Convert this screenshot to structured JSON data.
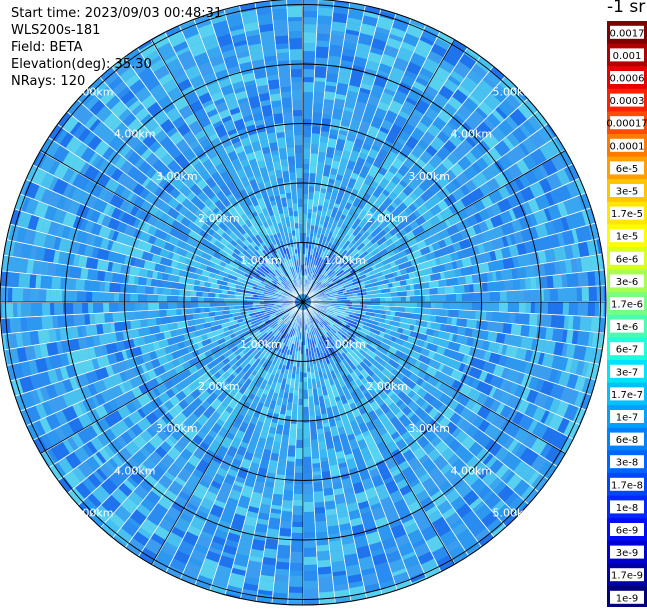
{
  "info": {
    "start_time": "Start time: 2023/09/03 00:48:31",
    "instrument": "WLS200s-181",
    "field": "Field: BETA",
    "elevation": "Elevation(deg): 35.30",
    "nrays": "NRays: 120"
  },
  "chart_data": {
    "type": "heatmap",
    "projection": "polar-ppi",
    "nrays": 120,
    "max_range_km": 5.0,
    "ring_labels": [
      "1.00km",
      "2.00km",
      "3.00km",
      "4.00km",
      "5.00km"
    ],
    "ring_label_units": "km",
    "spokes": 12,
    "colorbar": {
      "title": "-1 sr",
      "labels": [
        "0.0017",
        "0.001",
        "0.0006",
        "0.0003",
        "0.00017",
        "0.0001",
        "6e-5",
        "3e-5",
        "1.7e-5",
        "1e-5",
        "6e-6",
        "3e-6",
        "1.7e-6",
        "1e-6",
        "6e-7",
        "3e-7",
        "1.7e-7",
        "1e-7",
        "6e-8",
        "3e-8",
        "1.7e-8",
        "1e-8",
        "6e-9",
        "3e-9",
        "1.7e-9",
        "1e-9"
      ],
      "colors": [
        "#7f0000",
        "#b00000",
        "#e60000",
        "#ff2000",
        "#ff4c00",
        "#ff7a00",
        "#ffa000",
        "#ffc600",
        "#ffe600",
        "#fffc00",
        "#d8ff1e",
        "#a6ff50",
        "#78ff80",
        "#48ffb0",
        "#1effdc",
        "#00e2ff",
        "#00c0ff",
        "#00a0ff",
        "#0082ff",
        "#0064ff",
        "#0046ff",
        "#0028ff",
        "#000cf6",
        "#0000d2",
        "#0000a6",
        "#00007a"
      ]
    },
    "color_scale": {
      "near": [
        "#1e5ef0",
        "#2a86f0",
        "#3aa0f0",
        "#4ec8f4",
        "#2f78f0",
        "#60d0f0"
      ],
      "mid": [
        "#34a4f0",
        "#3cb8f0",
        "#2a90f0",
        "#46c4f0",
        "#56d4f4",
        "#2c86ec",
        "#3aa8f0"
      ],
      "far": [
        "#2a8cf0",
        "#3aa6f0",
        "#1f74ee",
        "#48c0f0",
        "#2c98f0",
        "#58d0f0",
        "#3c9cf0"
      ]
    }
  }
}
